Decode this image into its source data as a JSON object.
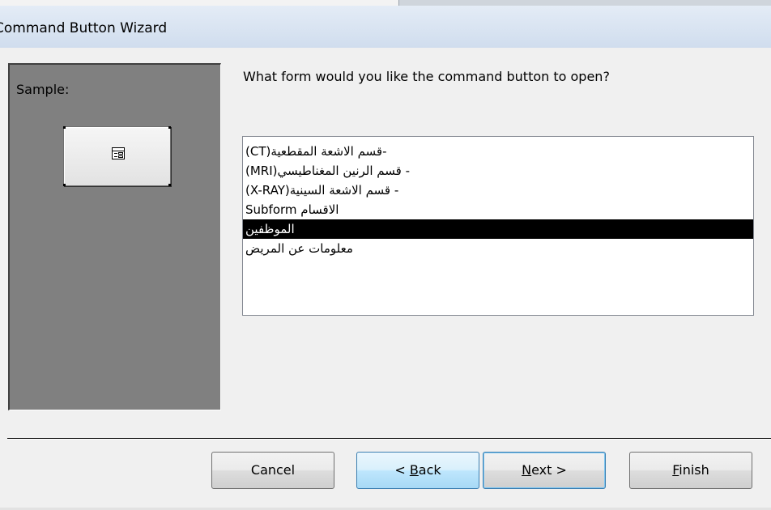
{
  "window": {
    "title": "Command Button Wizard"
  },
  "sample": {
    "label": "Sample:",
    "button_icon": "form-icon"
  },
  "prompt": {
    "question": "What form would you like the command button to open?"
  },
  "forms": {
    "items": [
      "-قسم الاشعة المقطعية(CT)",
      "- قسم الرنين المغناطيسي(MRI)",
      "- قسم الاشعة السينية(X-RAY)",
      "الاقسام Subform",
      "الموظفين",
      "معلومات عن المريض"
    ],
    "selected_index": 4
  },
  "buttons": {
    "cancel": "Cancel",
    "back_prefix": "< ",
    "back_accel": "B",
    "back_rest": "ack",
    "next_accel": "N",
    "next_rest": "ext >",
    "finish_accel": "F",
    "finish_rest": "inish"
  }
}
